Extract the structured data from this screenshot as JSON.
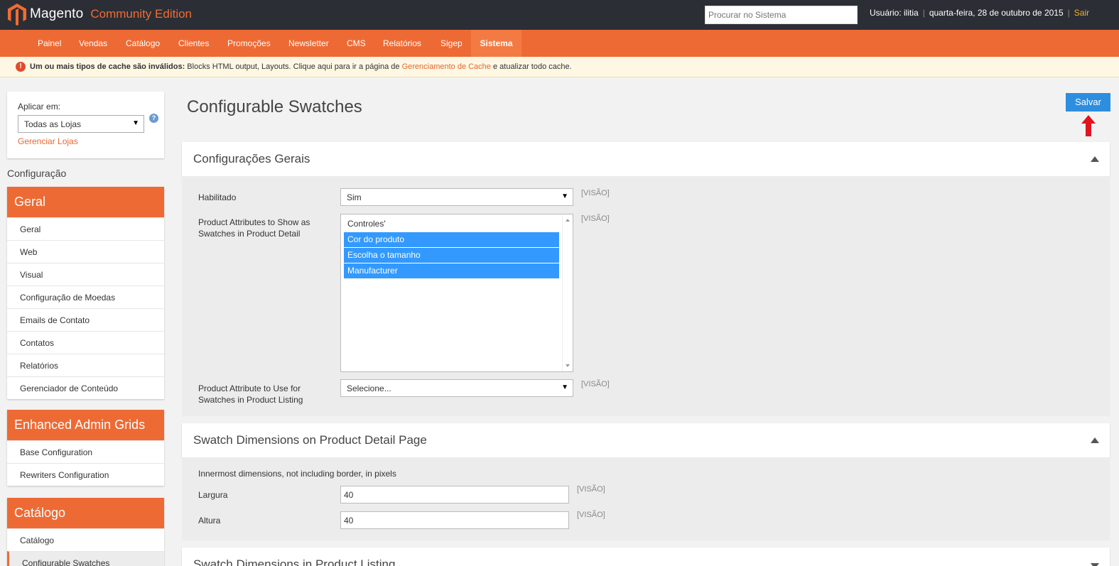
{
  "header": {
    "logo_text": "Magento",
    "edition": "Community Edition",
    "search_placeholder": "Procurar no Sistema",
    "user": "Usuário: ilitia",
    "date": "quarta-feira, 28 de outubro de 2015",
    "logout": "Sair",
    "separator": "|"
  },
  "nav": {
    "items": [
      {
        "label": "Painel"
      },
      {
        "label": "Vendas"
      },
      {
        "label": "Catálogo"
      },
      {
        "label": "Clientes"
      },
      {
        "label": "Promoções"
      },
      {
        "label": "Newsletter"
      },
      {
        "label": "CMS"
      },
      {
        "label": "Relatórios"
      },
      {
        "label": "Sigep"
      },
      {
        "label": "Sistema"
      }
    ],
    "active": "Sistema"
  },
  "alert": {
    "icon": "!",
    "bold": "Um ou mais tipos de cache são inválidos:",
    "text": " Blocks HTML output, Layouts. Clique aqui para ir a página de ",
    "link": "Gerenciamento de Cache",
    "tail": " e atualizar todo cache."
  },
  "scope": {
    "label": "Aplicar em:",
    "value": "Todas as Lojas",
    "manage_link": "Gerenciar Lojas",
    "help": "?"
  },
  "sidebar": {
    "config_label": "Configuração",
    "sections": [
      {
        "title": "Geral",
        "items": [
          {
            "label": "Geral"
          },
          {
            "label": "Web"
          },
          {
            "label": "Visual"
          },
          {
            "label": "Configuração de Moedas"
          },
          {
            "label": "Emails de Contato"
          },
          {
            "label": "Contatos"
          },
          {
            "label": "Relatórios"
          },
          {
            "label": "Gerenciador de Conteúdo"
          }
        ]
      },
      {
        "title": "Enhanced Admin Grids",
        "items": [
          {
            "label": "Base Configuration"
          },
          {
            "label": "Rewriters Configuration"
          }
        ]
      },
      {
        "title": "Catálogo",
        "items": [
          {
            "label": "Catálogo"
          },
          {
            "label": "Configurable Swatches"
          }
        ]
      }
    ]
  },
  "main": {
    "title": "Configurable Swatches",
    "save_label": "Salvar",
    "scope_tag": "[VISÃO]",
    "general": {
      "title": "Configurações Gerais",
      "enabled_label": "Habilitado",
      "enabled_value": "Sim",
      "detail_label_1": "Product Attributes to Show as",
      "detail_label_2": "Swatches in Product Detail",
      "options": [
        {
          "label": "Controles'",
          "selected": false
        },
        {
          "label": "Cor do produto",
          "selected": true
        },
        {
          "label": "Escolha o tamanho",
          "selected": true
        },
        {
          "label": "Manufacturer",
          "selected": true
        }
      ],
      "listing_label_1": "Product Attribute to Use for",
      "listing_label_2": "Swatches in Product Listing",
      "listing_value": "Selecione..."
    },
    "detail_dims": {
      "title": "Swatch Dimensions on Product Detail Page",
      "note": "Innermost dimensions, not including border, in pixels",
      "width_label": "Largura",
      "width_value": "40",
      "height_label": "Altura",
      "height_value": "40"
    },
    "listing_dims": {
      "title": "Swatch Dimensions in Product Listing"
    }
  },
  "colors": {
    "brand_orange": "#ee6a34",
    "header_dark": "#2c2e36",
    "button_blue": "#2d8ee0",
    "selection_blue": "#3399ff",
    "arrow_red": "#e0141e"
  }
}
